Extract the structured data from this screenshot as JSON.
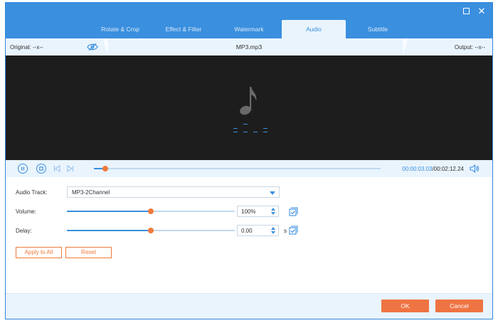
{
  "tabs": [
    {
      "label": "Rotate & Crop"
    },
    {
      "label": "Effect & Filter"
    },
    {
      "label": "Watermark"
    },
    {
      "label": "Audio"
    },
    {
      "label": "Subtitle"
    }
  ],
  "active_tab": "Audio",
  "window_controls": {
    "maximize_icon": "maximize-icon",
    "close_icon": "close-icon",
    "close_glyph": "✕"
  },
  "info_bar": {
    "original_label": "Original: --x--",
    "filename": "MP3.mp3",
    "output_label": "Output: --x--",
    "eye_icon": "eye-icon"
  },
  "preview": {
    "note_icon": "music-note-icon",
    "eq_icon": "equalizer-icon"
  },
  "playback": {
    "current_time": "00:00:03.03",
    "total_time": "/00:02:12.24",
    "progress": 0.04,
    "icons": [
      "pause-icon",
      "stop-icon",
      "previous-icon",
      "next-icon",
      "volume-icon"
    ]
  },
  "settings": {
    "audio_track_label": "Audio Track:",
    "audio_track_value": "MP3-2Channel",
    "volume_label": "Volume:",
    "volume_value": "100%",
    "volume_level": 0.5,
    "delay_label": "Delay:",
    "delay_value": "0.00",
    "delay_level": 0.5,
    "delay_unit": "s",
    "apply_all_label": "Apply to All",
    "reset_label": "Reset"
  },
  "footer": {
    "ok_label": "OK",
    "cancel_label": "Cancel"
  },
  "colors": {
    "accent": "#3a8fdf",
    "orange": "#ef7443",
    "panel": "#e9f4fd",
    "preview_bg": "#1d1d1d"
  }
}
